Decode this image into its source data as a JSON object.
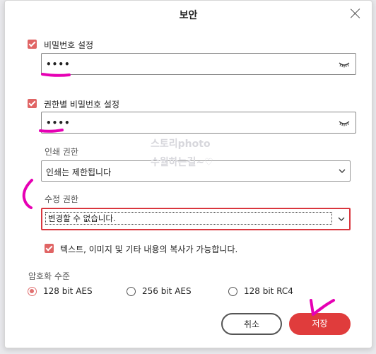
{
  "dialog": {
    "title": "보안",
    "password": {
      "label": "비밀번호 설정",
      "checked": true,
      "value": "••••"
    },
    "permission_password": {
      "label": "권한별 비밀번호 설정",
      "checked": true,
      "value": "••••"
    },
    "print_permission": {
      "label": "인쇄 권한",
      "selected": "인쇄는 제한됩니다"
    },
    "edit_permission": {
      "label": "수정 권한",
      "selected": "변경할 수 없습니다."
    },
    "copy_option": {
      "label": "텍스트, 이미지 및 기타 내용의 복사가 가능합니다.",
      "checked": true
    },
    "encryption": {
      "label": "암호화 수준",
      "options": [
        "128 bit AES",
        "256 bit AES",
        "128 bit RC4"
      ],
      "selected": "128 bit AES"
    },
    "buttons": {
      "cancel": "취소",
      "save": "저장"
    }
  },
  "watermark": {
    "line1": "스토리photo",
    "line2": "수월하는길~♡"
  },
  "colors": {
    "accent": "#e03c3c",
    "checkbox": "#e06464",
    "annotation": "#e600b4"
  }
}
